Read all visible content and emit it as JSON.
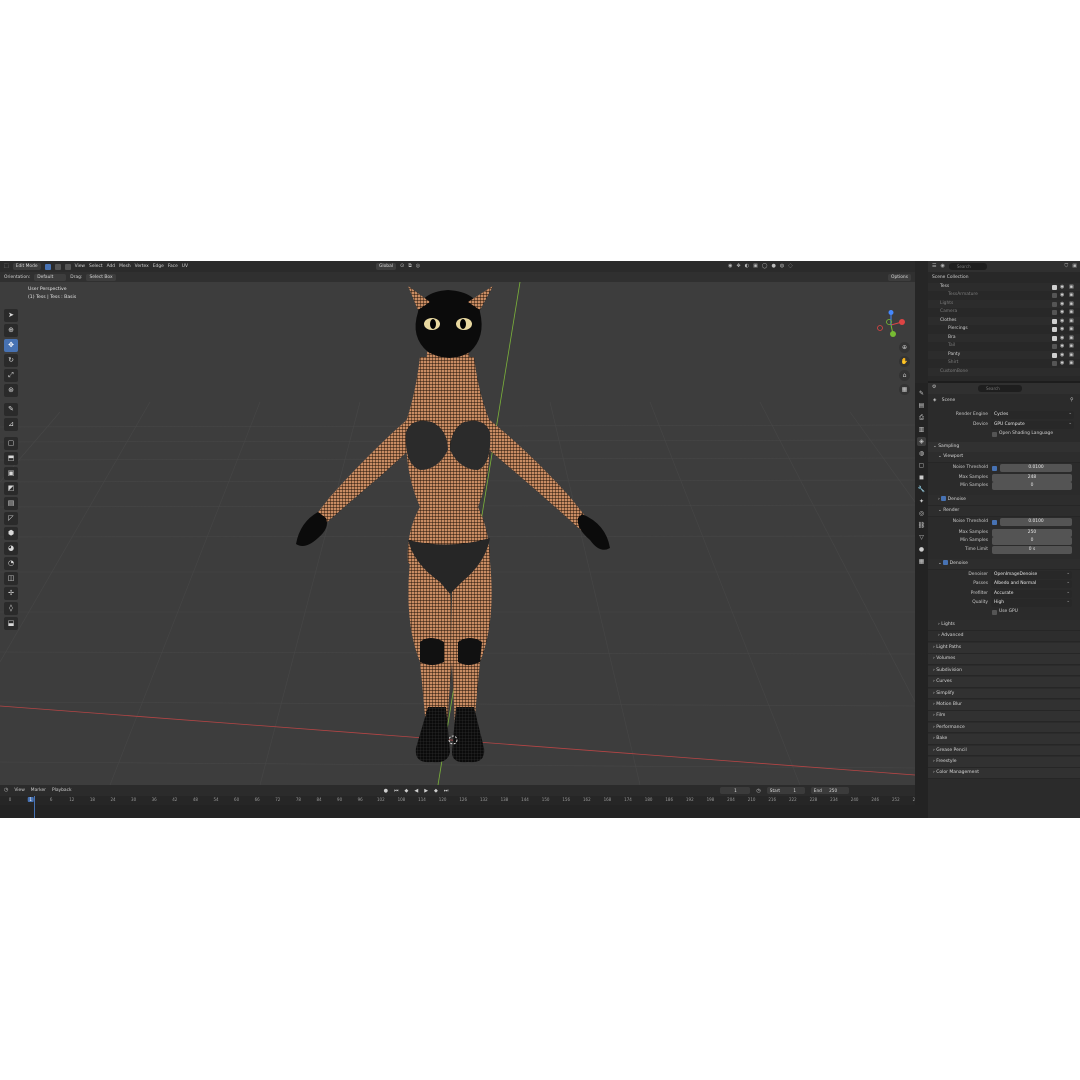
{
  "header": {
    "mode": "Edit Mode",
    "menus": [
      "View",
      "Select",
      "Add",
      "Mesh",
      "Vertex",
      "Edge",
      "Face",
      "UV"
    ],
    "transform_orientation": "Global",
    "options": "Options"
  },
  "tool_settings": {
    "orientation_label": "Orientation:",
    "orientation_value": "Default",
    "drag_label": "Drag:",
    "drag_value": "Select Box"
  },
  "viewport": {
    "view_name": "User Perspective",
    "object_info": "(1) Tess | Tess : Basis"
  },
  "outliner": {
    "search_placeholder": "Search",
    "rows": [
      {
        "label": "Scene Collection",
        "indent": 0,
        "dim": false,
        "icons": ""
      },
      {
        "label": "Tess",
        "indent": 1,
        "dim": false,
        "icons": "check eye cam"
      },
      {
        "label": "TessArmature",
        "indent": 2,
        "dim": true,
        "icons": "eye cam"
      },
      {
        "label": "Lights",
        "indent": 1,
        "dim": true,
        "icons": "eye cam"
      },
      {
        "label": "Camera",
        "indent": 1,
        "dim": true,
        "icons": "eye cam"
      },
      {
        "label": "Clothes",
        "indent": 1,
        "dim": false,
        "icons": "check eye cam"
      },
      {
        "label": "Piercings",
        "indent": 2,
        "dim": false,
        "icons": "check eye cam"
      },
      {
        "label": "Bra",
        "indent": 2,
        "dim": false,
        "icons": "check eye cam"
      },
      {
        "label": "Tail",
        "indent": 2,
        "dim": true,
        "icons": "eye cam"
      },
      {
        "label": "Panty",
        "indent": 2,
        "dim": false,
        "icons": "check eye cam"
      },
      {
        "label": "Shirt",
        "indent": 2,
        "dim": true,
        "icons": "eye cam"
      },
      {
        "label": "CustomBone",
        "indent": 1,
        "dim": true,
        "icons": ""
      }
    ]
  },
  "properties": {
    "search_placeholder": "Search",
    "context": "Scene",
    "render_engine_label": "Render Engine",
    "render_engine_value": "Cycles",
    "device_label": "Device",
    "device_value": "GPU Compute",
    "osl_label": "Open Shading Language",
    "sampling": "Sampling",
    "viewport_sub": "Viewport",
    "noise_threshold_label": "Noise Threshold",
    "vp_noise_threshold": "0.0100",
    "max_samples_label": "Max Samples",
    "vp_max_samples": "248",
    "min_samples_label": "Min Samples",
    "vp_min_samples": "0",
    "denoise_label": "Denoise",
    "render_sub": "Render",
    "r_noise_threshold": "0.0100",
    "r_max_samples": "250",
    "r_min_samples": "0",
    "time_limit_label": "Time Limit",
    "r_time_limit": "0 s",
    "denoiser_label": "Denoiser",
    "denoiser_value": "OpenImageDenoise",
    "passes_label": "Passes",
    "passes_value": "Albedo and Normal",
    "prefilter_label": "Prefilter",
    "prefilter_value": "Accurate",
    "quality_label": "Quality",
    "quality_value": "High",
    "use_gpu_label": "Use GPU",
    "lights_sub": "Lights",
    "advanced_sub": "Advanced",
    "sections": [
      "Light Paths",
      "Volumes",
      "Subdivision",
      "Curves",
      "Simplify",
      "Motion Blur",
      "Film",
      "Performance",
      "Bake",
      "Grease Pencil",
      "Freestyle",
      "Color Management"
    ]
  },
  "timeline": {
    "menus": [
      "View",
      "Marker",
      "Playback"
    ],
    "current_frame": "1",
    "start_label": "Start",
    "start_value": "1",
    "end_label": "End",
    "end_value": "250",
    "ruler": [
      "0",
      "1",
      "6",
      "12",
      "18",
      "24",
      "30",
      "36",
      "42",
      "48",
      "54",
      "60",
      "66",
      "72",
      "78",
      "84",
      "90",
      "96",
      "102",
      "108",
      "114",
      "120",
      "126",
      "132",
      "138",
      "144",
      "150",
      "156",
      "162",
      "168",
      "174",
      "180",
      "186",
      "192",
      "198",
      "204",
      "210",
      "216",
      "222",
      "228",
      "234",
      "240",
      "246",
      "252",
      "258"
    ]
  },
  "colors": {
    "accent": "#4772b3",
    "viewport_bg": "#3d3d3d",
    "x_axis": "#b54545",
    "y_axis": "#7bb33a",
    "mesh_wire": "#1a0e05",
    "skin": "#c98c63"
  }
}
